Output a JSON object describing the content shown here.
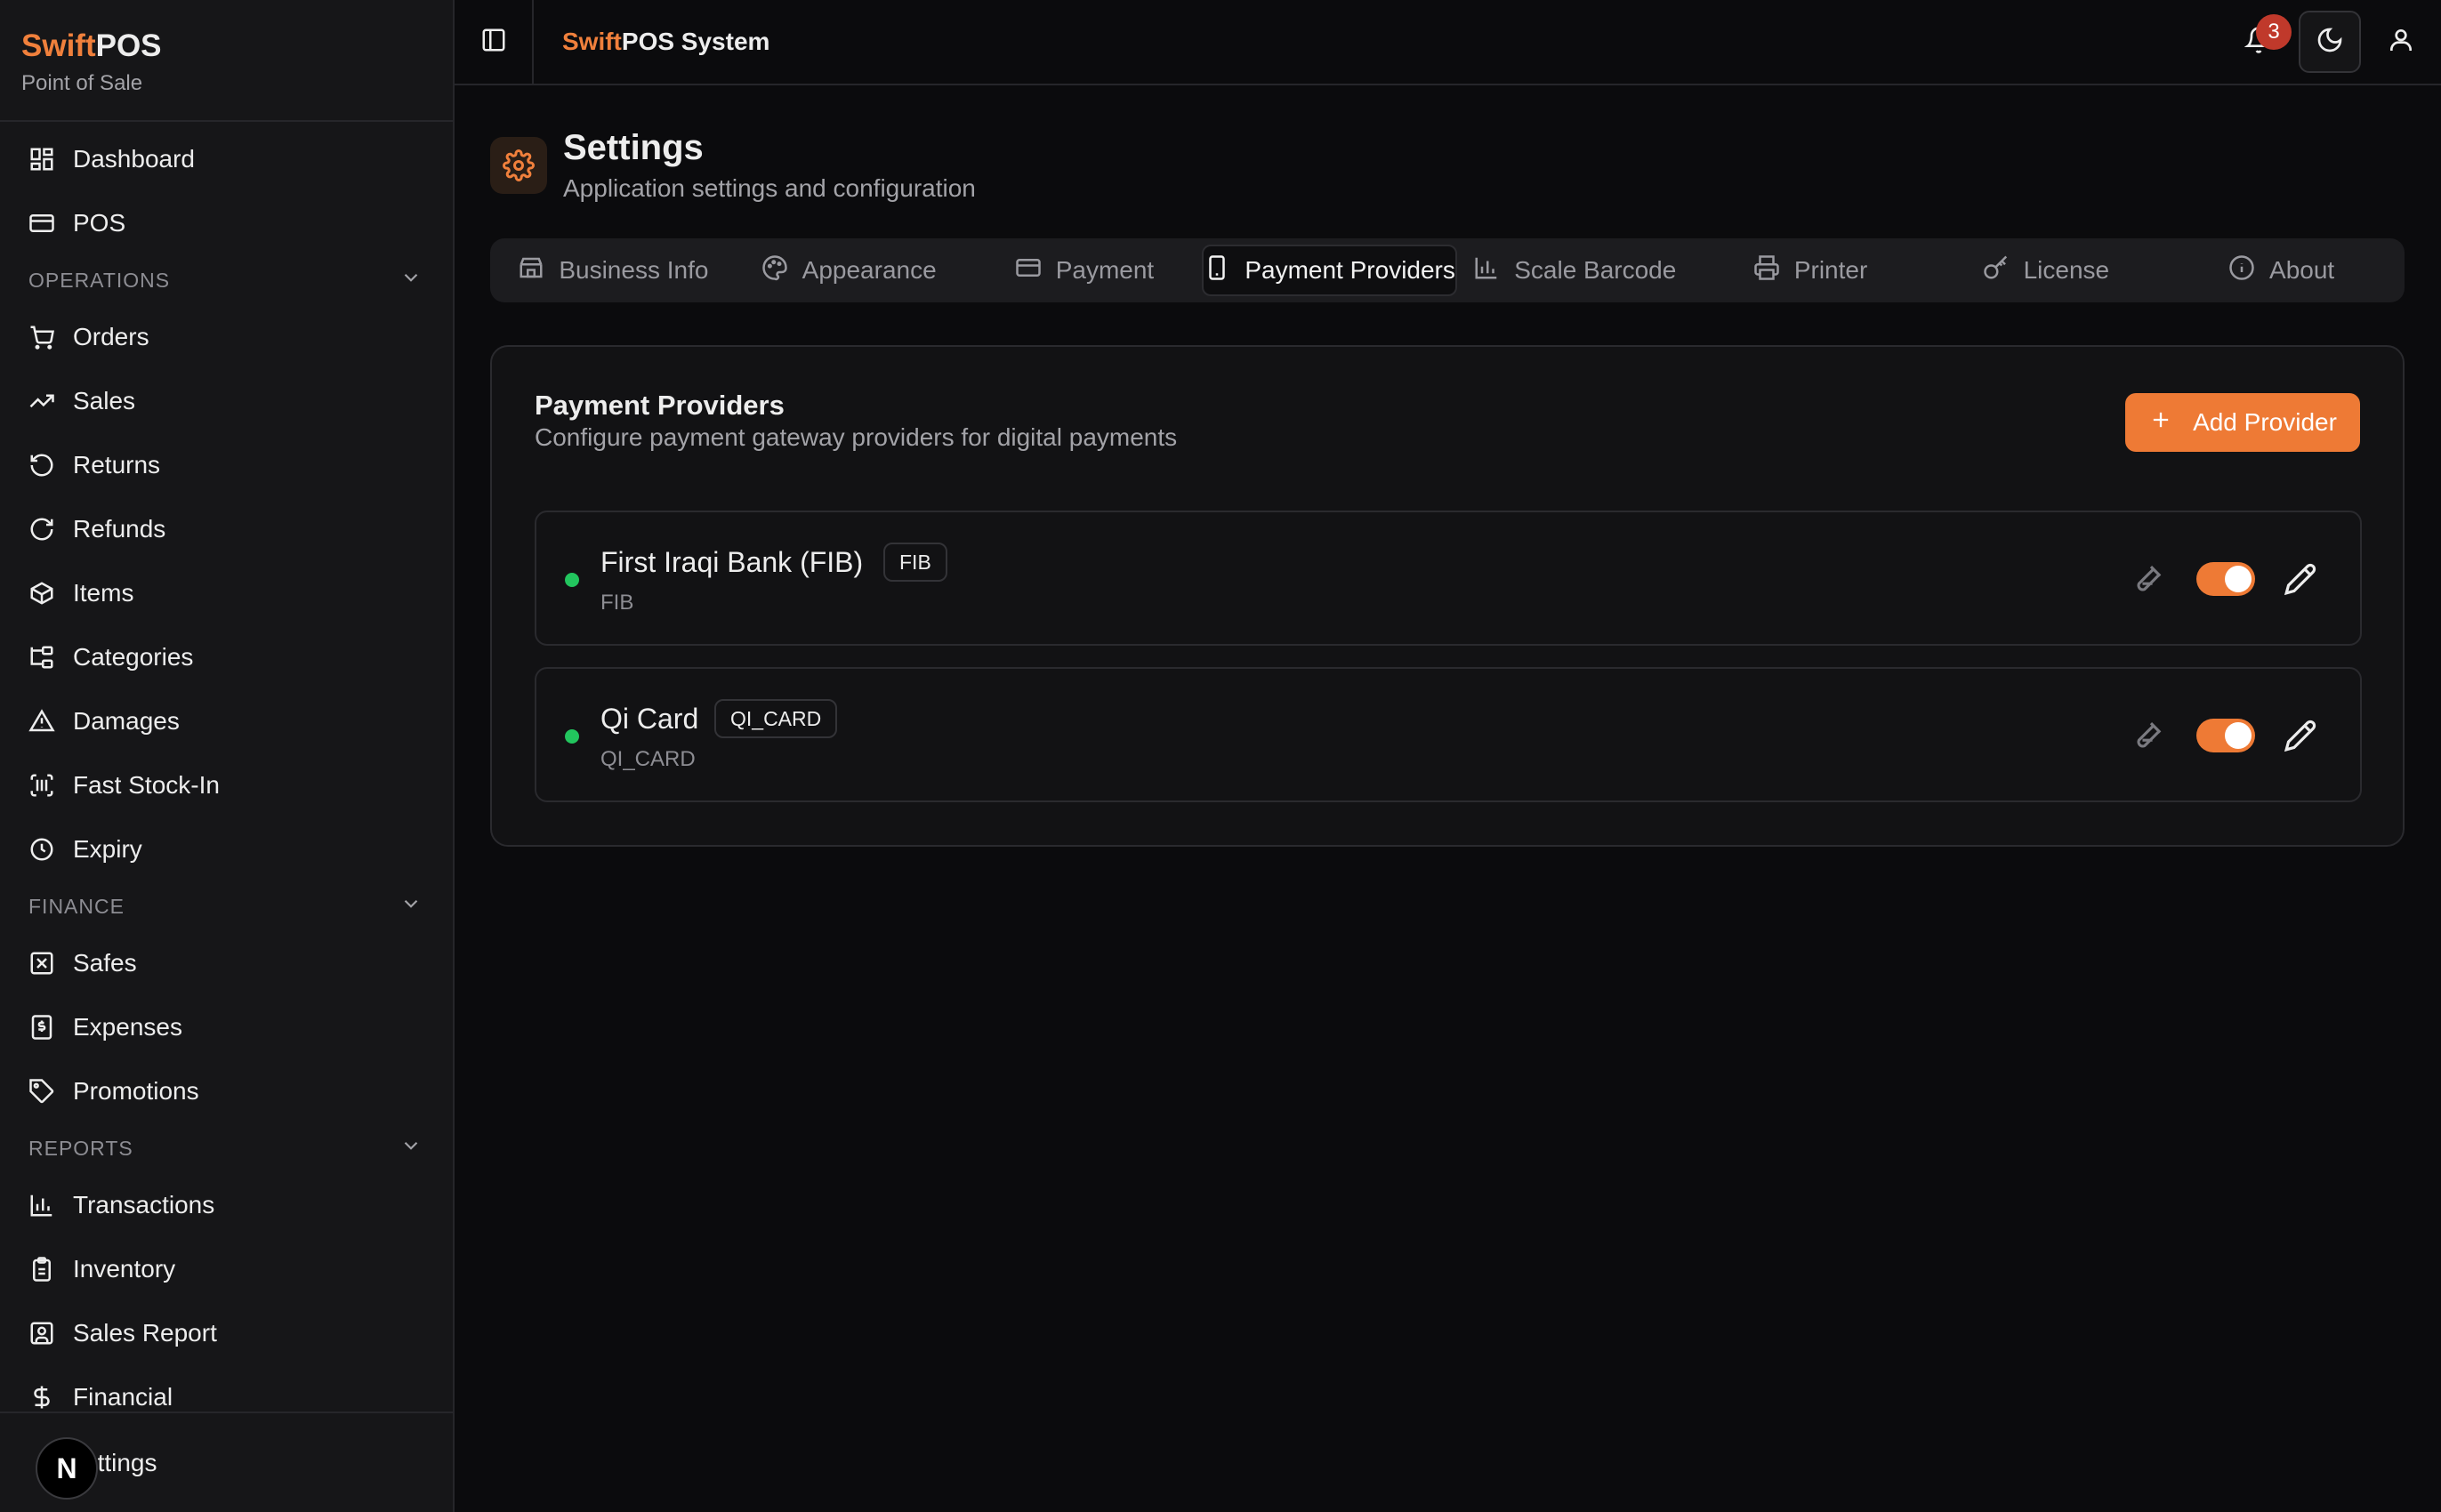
{
  "sidebar": {
    "brand_part1": "Swift",
    "brand_part2": "POS",
    "brand_sub": "Point of Sale",
    "top_items": [
      {
        "label": "Dashboard",
        "icon": "dashboard-icon"
      },
      {
        "label": "POS",
        "icon": "credit-card-icon"
      }
    ],
    "sections": [
      {
        "title": "OPERATIONS",
        "items": [
          {
            "label": "Orders",
            "icon": "cart-icon"
          },
          {
            "label": "Sales",
            "icon": "trending-up-icon"
          },
          {
            "label": "Returns",
            "icon": "rotate-ccw-icon"
          },
          {
            "label": "Refunds",
            "icon": "refresh-icon"
          },
          {
            "label": "Items",
            "icon": "package-icon"
          },
          {
            "label": "Categories",
            "icon": "folder-tree-icon"
          },
          {
            "label": "Damages",
            "icon": "alert-triangle-icon"
          },
          {
            "label": "Fast Stock-In",
            "icon": "scan-barcode-icon"
          },
          {
            "label": "Expiry",
            "icon": "clock-icon"
          }
        ]
      },
      {
        "title": "FINANCE",
        "items": [
          {
            "label": "Safes",
            "icon": "safe-icon"
          },
          {
            "label": "Expenses",
            "icon": "receipt-icon"
          },
          {
            "label": "Promotions",
            "icon": "tag-icon"
          }
        ]
      },
      {
        "title": "REPORTS",
        "items": [
          {
            "label": "Transactions",
            "icon": "bar-chart-icon"
          },
          {
            "label": "Inventory",
            "icon": "clipboard-icon"
          },
          {
            "label": "Sales Report",
            "icon": "user-square-icon"
          },
          {
            "label": "Financial",
            "icon": "dollar-icon"
          }
        ]
      }
    ],
    "footer_label": "ettings",
    "footer_avatar": "N"
  },
  "topbar": {
    "title_part1": "Swift",
    "title_part2": "POS System",
    "notification_count": "3"
  },
  "page": {
    "title": "Settings",
    "subtitle": "Application settings and configuration"
  },
  "tabs": [
    {
      "label": "Business Info",
      "icon": "store-icon",
      "active": false
    },
    {
      "label": "Appearance",
      "icon": "palette-icon",
      "active": false
    },
    {
      "label": "Payment",
      "icon": "credit-card-icon",
      "active": false
    },
    {
      "label": "Payment Providers",
      "icon": "smartphone-icon",
      "active": true
    },
    {
      "label": "Scale Barcode",
      "icon": "bar-chart-icon",
      "active": false
    },
    {
      "label": "Printer",
      "icon": "printer-icon",
      "active": false
    },
    {
      "label": "License",
      "icon": "key-icon",
      "active": false
    },
    {
      "label": "About",
      "icon": "info-icon",
      "active": false
    }
  ],
  "card": {
    "title": "Payment Providers",
    "subtitle": "Configure payment gateway providers for digital payments",
    "add_label": "Add Provider"
  },
  "providers": [
    {
      "name": "First Iraqi Bank (FIB)",
      "badge": "FIB",
      "code": "FIB",
      "enabled": true
    },
    {
      "name": "Qi Card",
      "badge": "QI_CARD",
      "code": "QI_CARD",
      "enabled": true
    }
  ],
  "colors": {
    "accent": "#ee7a35",
    "status_active": "#22c55e",
    "notification": "#c0392b"
  }
}
